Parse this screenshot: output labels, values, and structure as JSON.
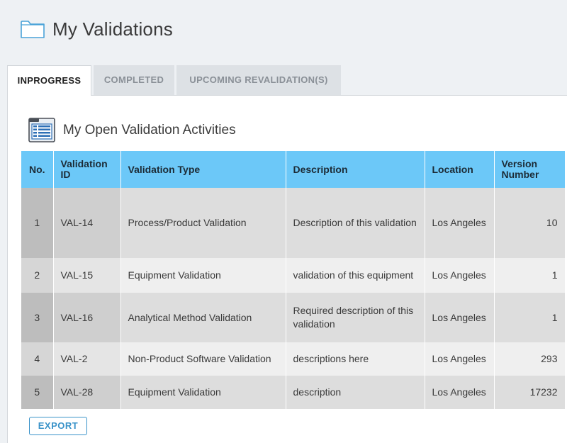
{
  "page": {
    "title": "My Validations"
  },
  "tabs": [
    {
      "label": "INPROGRESS",
      "active": true
    },
    {
      "label": "COMPLETED",
      "active": false
    },
    {
      "label": "UPCOMING REVALIDATION(S)",
      "active": false
    }
  ],
  "section": {
    "title": "My Open Validation Activities"
  },
  "table": {
    "columns": [
      "No.",
      "Validation ID",
      "Validation Type",
      "Description",
      "Location",
      "Version Number"
    ],
    "rows": [
      {
        "no": "1",
        "id": "VAL-14",
        "type": "Process/Product Validation",
        "description": "Description of this validation",
        "location": "Los Angeles",
        "version": "10"
      },
      {
        "no": "2",
        "id": "VAL-15",
        "type": "Equipment Validation",
        "description": "validation of this equipment",
        "location": "Los Angeles",
        "version": "1"
      },
      {
        "no": "3",
        "id": "VAL-16",
        "type": "Analytical Method Validation",
        "description": "Required description of this validation",
        "location": "Los Angeles",
        "version": "1"
      },
      {
        "no": "4",
        "id": "VAL-2",
        "type": "Non-Product Software Validation",
        "description": "descriptions here",
        "location": "Los Angeles",
        "version": "293"
      },
      {
        "no": "5",
        "id": "VAL-28",
        "type": "Equipment Validation",
        "description": "description",
        "location": "Los Angeles",
        "version": "17232"
      }
    ]
  },
  "actions": {
    "export_label": "EXPORT"
  },
  "colors": {
    "header_blue": "#6cc8f8",
    "accent": "#3a93c9",
    "icon_blue": "#4aa3d8"
  },
  "icons": {
    "title_icon": "folder-icon",
    "section_icon": "table-icon"
  }
}
